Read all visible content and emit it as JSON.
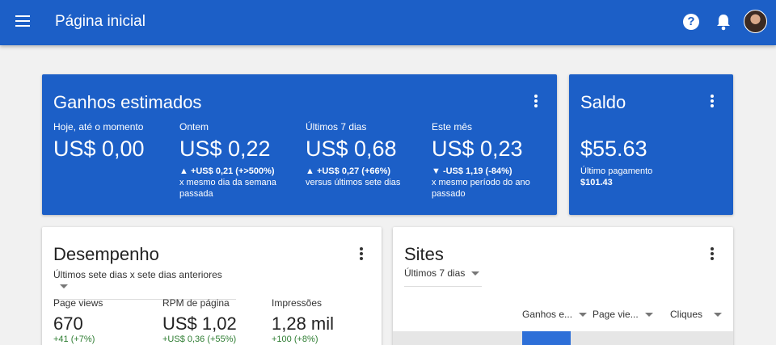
{
  "appbar": {
    "title": "Página inicial",
    "icons": [
      "menu-icon",
      "help-icon",
      "bell-icon",
      "avatar"
    ]
  },
  "earnings": {
    "title": "Ganhos estimados",
    "cols": [
      {
        "label": "Hoje, até o momento",
        "value": "US$ 0,00",
        "delta": "",
        "compare": ""
      },
      {
        "label": "Ontem",
        "value": "US$ 0,22",
        "delta": "▲ +US$ 0,21 (+>500%)",
        "compare": "x mesmo dia da semana passada"
      },
      {
        "label": "Últimos 7 dias",
        "value": "US$ 0,68",
        "delta": "▲ +US$ 0,27 (+66%)",
        "compare": "versus últimos sete dias"
      },
      {
        "label": "Este mês",
        "value": "US$ 0,23",
        "delta": "▼ -US$ 1,19 (-84%)",
        "compare": "x mesmo período do ano passado"
      }
    ]
  },
  "balance": {
    "title": "Saldo",
    "value": "$55.63",
    "last_payment_label": "Último pagamento",
    "last_payment_value": "$101.43"
  },
  "performance": {
    "title": "Desempenho",
    "range": "Últimos sete dias x sete dias anteriores",
    "metrics": [
      {
        "label": "Page views",
        "value": "670",
        "delta": "+41 (+7%)"
      },
      {
        "label": "RPM de página",
        "value": "US$ 1,02",
        "delta": "+US$ 0,36 (+55%)"
      },
      {
        "label": "Impressões",
        "value": "1,28 mil",
        "delta": "+100 (+8%)"
      }
    ]
  },
  "sites": {
    "title": "Sites",
    "range": "Últimos 7 dias",
    "columns": [
      "Ganhos e...",
      "Page vie...",
      "Cliques"
    ]
  },
  "colors": {
    "accent": "#1c5fc7",
    "positive": "#2e7d32"
  }
}
